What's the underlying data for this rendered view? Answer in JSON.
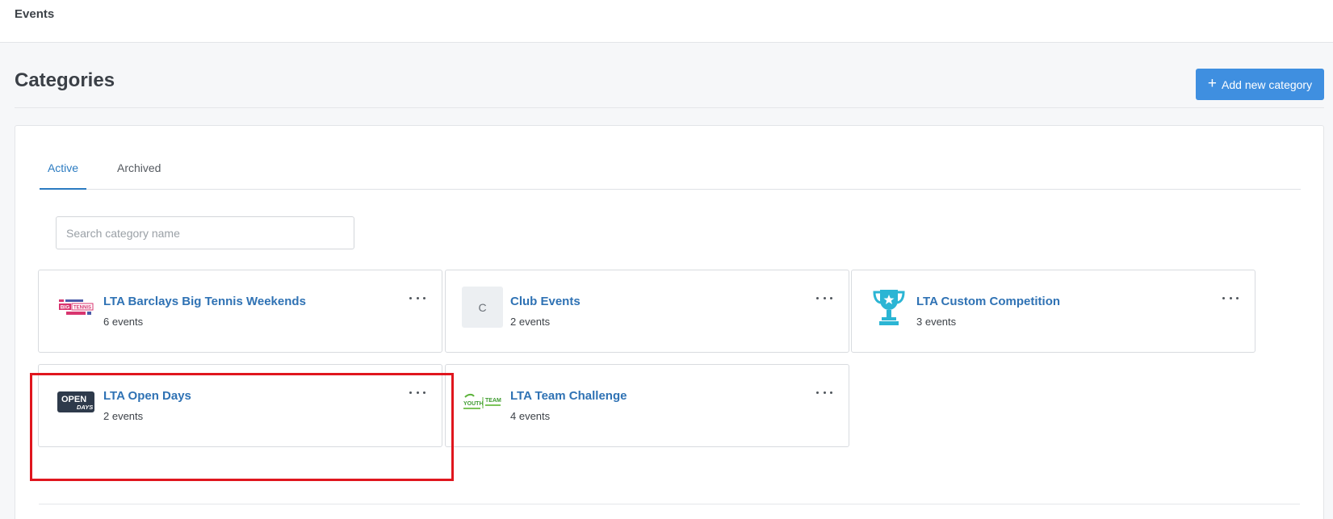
{
  "topbar": {
    "title": "Events"
  },
  "page": {
    "title": "Categories",
    "add_button_label": "Add new category"
  },
  "tabs": [
    {
      "label": "Active",
      "active": true
    },
    {
      "label": "Archived",
      "active": false
    }
  ],
  "search": {
    "placeholder": "Search category name",
    "value": ""
  },
  "categories": [
    {
      "name": "LTA Barclays Big Tennis Weekends",
      "count": "6 events",
      "icon": "big-tennis-weekends-logo"
    },
    {
      "name": "Club Events",
      "count": "2 events",
      "icon": "letter-avatar",
      "initial": "C"
    },
    {
      "name": "LTA Custom Competition",
      "count": "3 events",
      "icon": "trophy-icon"
    },
    {
      "name": "LTA Open Days",
      "count": "2 events",
      "icon": "open-days-logo",
      "logo_text": [
        "OPEN",
        "DAYS"
      ]
    },
    {
      "name": "LTA Team Challenge",
      "count": "4 events",
      "icon": "youth-team-challenge-logo",
      "logo_text": [
        "YOUTH",
        "TEAM"
      ]
    }
  ],
  "colors": {
    "accent": "#3f8fe0",
    "link": "#2f72b4",
    "highlight": "#e0161e"
  }
}
